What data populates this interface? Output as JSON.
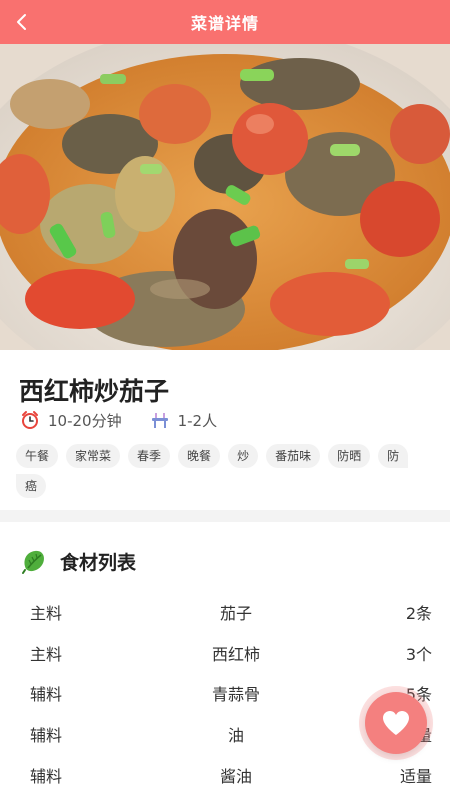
{
  "header": {
    "title": "菜谱详情",
    "back_icon": "chevron-left-icon"
  },
  "colors": {
    "accent": "#f9716f",
    "fav_button": "#f4807f",
    "tag_bg": "#f2f2f2"
  },
  "recipe": {
    "title": "西红柿炒茄子",
    "time": "10-20分钟",
    "servings": "1-2人",
    "time_icon": "alarm-clock-icon",
    "servings_icon": "dining-table-icon",
    "tags": [
      "午餐",
      "家常菜",
      "春季",
      "晚餐",
      "炒",
      "番茄味",
      "防晒",
      "防",
      "癌"
    ]
  },
  "ingredients": {
    "title": "食材列表",
    "icon": "leaf-vegetable-icon",
    "rows": [
      {
        "type": "主料",
        "name": "茄子",
        "qty": "2条"
      },
      {
        "type": "主料",
        "name": "西红柿",
        "qty": "3个"
      },
      {
        "type": "辅料",
        "name": "青蒜骨",
        "qty": "5条"
      },
      {
        "type": "辅料",
        "name": "油",
        "qty": "量"
      },
      {
        "type": "辅料",
        "name": "酱油",
        "qty": "适量"
      }
    ]
  },
  "fav_icon": "heart-icon"
}
